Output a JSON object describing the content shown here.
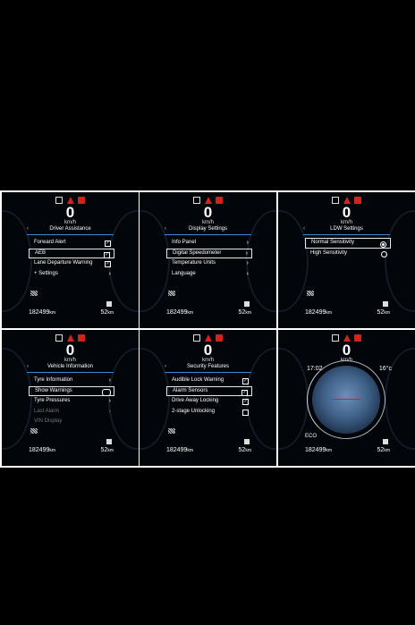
{
  "speed_unit": "km/h",
  "odometer": "182499",
  "odometer_unit": "km",
  "range": "52",
  "range_unit": "km",
  "panels": [
    {
      "title": "Driver Assistance",
      "speed": "0",
      "items": [
        {
          "label": "Forward Alert",
          "control": "checkbox",
          "checked": true
        },
        {
          "label": "AEB",
          "control": "checkbox",
          "checked": true,
          "selected": true
        },
        {
          "label": "Lane Departure Warning",
          "control": "checkbox",
          "checked": true
        },
        {
          "label": "+ Settings",
          "control": "arrow"
        }
      ]
    },
    {
      "title": "Display Settings",
      "speed": "0",
      "items": [
        {
          "label": "Info Panel",
          "control": "arrow"
        },
        {
          "label": "Digital Speedometer",
          "control": "arrow",
          "selected": true
        },
        {
          "label": "Temperature Units",
          "control": "arrow"
        },
        {
          "label": "Language",
          "control": "arrow"
        }
      ]
    },
    {
      "title": "LDW Settings",
      "speed": "0",
      "items": [
        {
          "label": "Normal Sensitivity",
          "control": "radio",
          "checked": true,
          "selected": true
        },
        {
          "label": "High Sensitivity",
          "control": "radio",
          "checked": false
        }
      ]
    },
    {
      "title": "Vehicle Information",
      "speed": "0",
      "items": [
        {
          "label": "Tyre Information",
          "control": "arrow"
        },
        {
          "label": "Show Warnings",
          "control": "toggle",
          "selected": true
        },
        {
          "label": "Tyre Pressures",
          "control": "arrow"
        },
        {
          "label": "Last Alarm",
          "control": "arrow",
          "dim": true
        },
        {
          "label": "VIN Display",
          "control": "none",
          "dim": true
        }
      ]
    },
    {
      "title": "Security Features",
      "speed": "0",
      "items": [
        {
          "label": "Audible Lock Warning",
          "control": "checkbox",
          "checked": true
        },
        {
          "label": "Alarm Sensors",
          "control": "checkbox",
          "checked": true,
          "selected": true
        },
        {
          "label": "Drive Away Locking",
          "control": "checkbox",
          "checked": true
        },
        {
          "label": "2-stage Unlocking",
          "control": "checkbox",
          "checked": false
        }
      ]
    },
    {
      "title": "",
      "speed": "0",
      "time": "17:02",
      "temperature": "16°c",
      "mode": "ECO"
    }
  ]
}
